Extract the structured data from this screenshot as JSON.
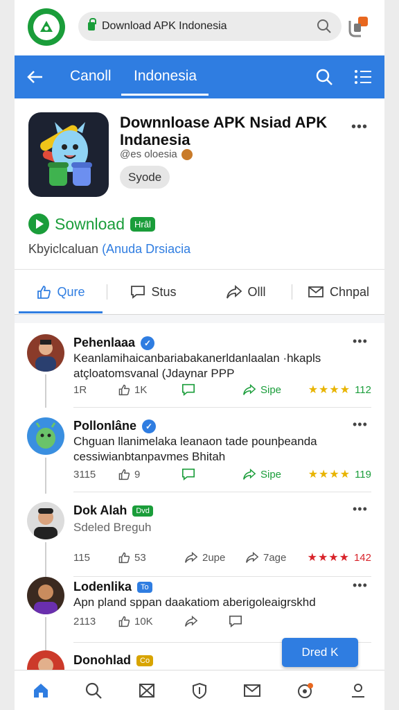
{
  "browser": {
    "url_text": "Download APK Indonesia"
  },
  "nav": {
    "tabs": [
      {
        "label": "Canoll"
      },
      {
        "label": "Indonesia"
      }
    ]
  },
  "app": {
    "title": "Downnloase APK Nsiad APK Indanesia",
    "subtitle": "@es oloesia",
    "chip": "Syode",
    "download_label": "Sownload",
    "download_badge": "Hrâl",
    "description_plain": "Kbyiclcaluan ",
    "description_link": "(Anuda  Drsiacia",
    "actions": [
      {
        "label": "Qure",
        "icon": "thumbs-up-icon"
      },
      {
        "label": "Stus",
        "icon": "comment-icon"
      },
      {
        "label": "Olll",
        "icon": "share-icon"
      },
      {
        "label": "Chnpal",
        "icon": "mail-icon"
      }
    ]
  },
  "posts": [
    {
      "name": "Pehenlaaa",
      "text": "Keanlamihaicanbariabakanerldanlaalan ·hkapls atçloatomsvanal (Jdaynar PPP",
      "replies": "1R",
      "likes": "1K",
      "share_label": "Sipe",
      "rating": "112"
    },
    {
      "name": "Pollonlâne",
      "text": "Chguan  llanimelaka leanaon tade pounþeanda cessiwianbtanpavmes Bhitah",
      "replies": "3115",
      "likes": "9",
      "share_label": "Sipe",
      "rating": "119"
    },
    {
      "name": "Dok Alah",
      "badge": "Dvd",
      "text": "Sdeled Breguh",
      "replies": "115",
      "likes": "53",
      "share_label": "2upe",
      "share2_label": "7age",
      "rating": "142"
    },
    {
      "name": "Lodenlika",
      "badge": "To",
      "text": "Apn pland sppan daakatiom aberigoleaigrskhd",
      "replies": "2113",
      "likes": "10K"
    },
    {
      "name": "Donohlad",
      "badge": "Co"
    }
  ],
  "fab_label": "Dred K",
  "colors": {
    "primary": "#2f7de1",
    "accent_green": "#1a9d3a",
    "star": "#e8b400",
    "star_red": "#d8232a"
  }
}
